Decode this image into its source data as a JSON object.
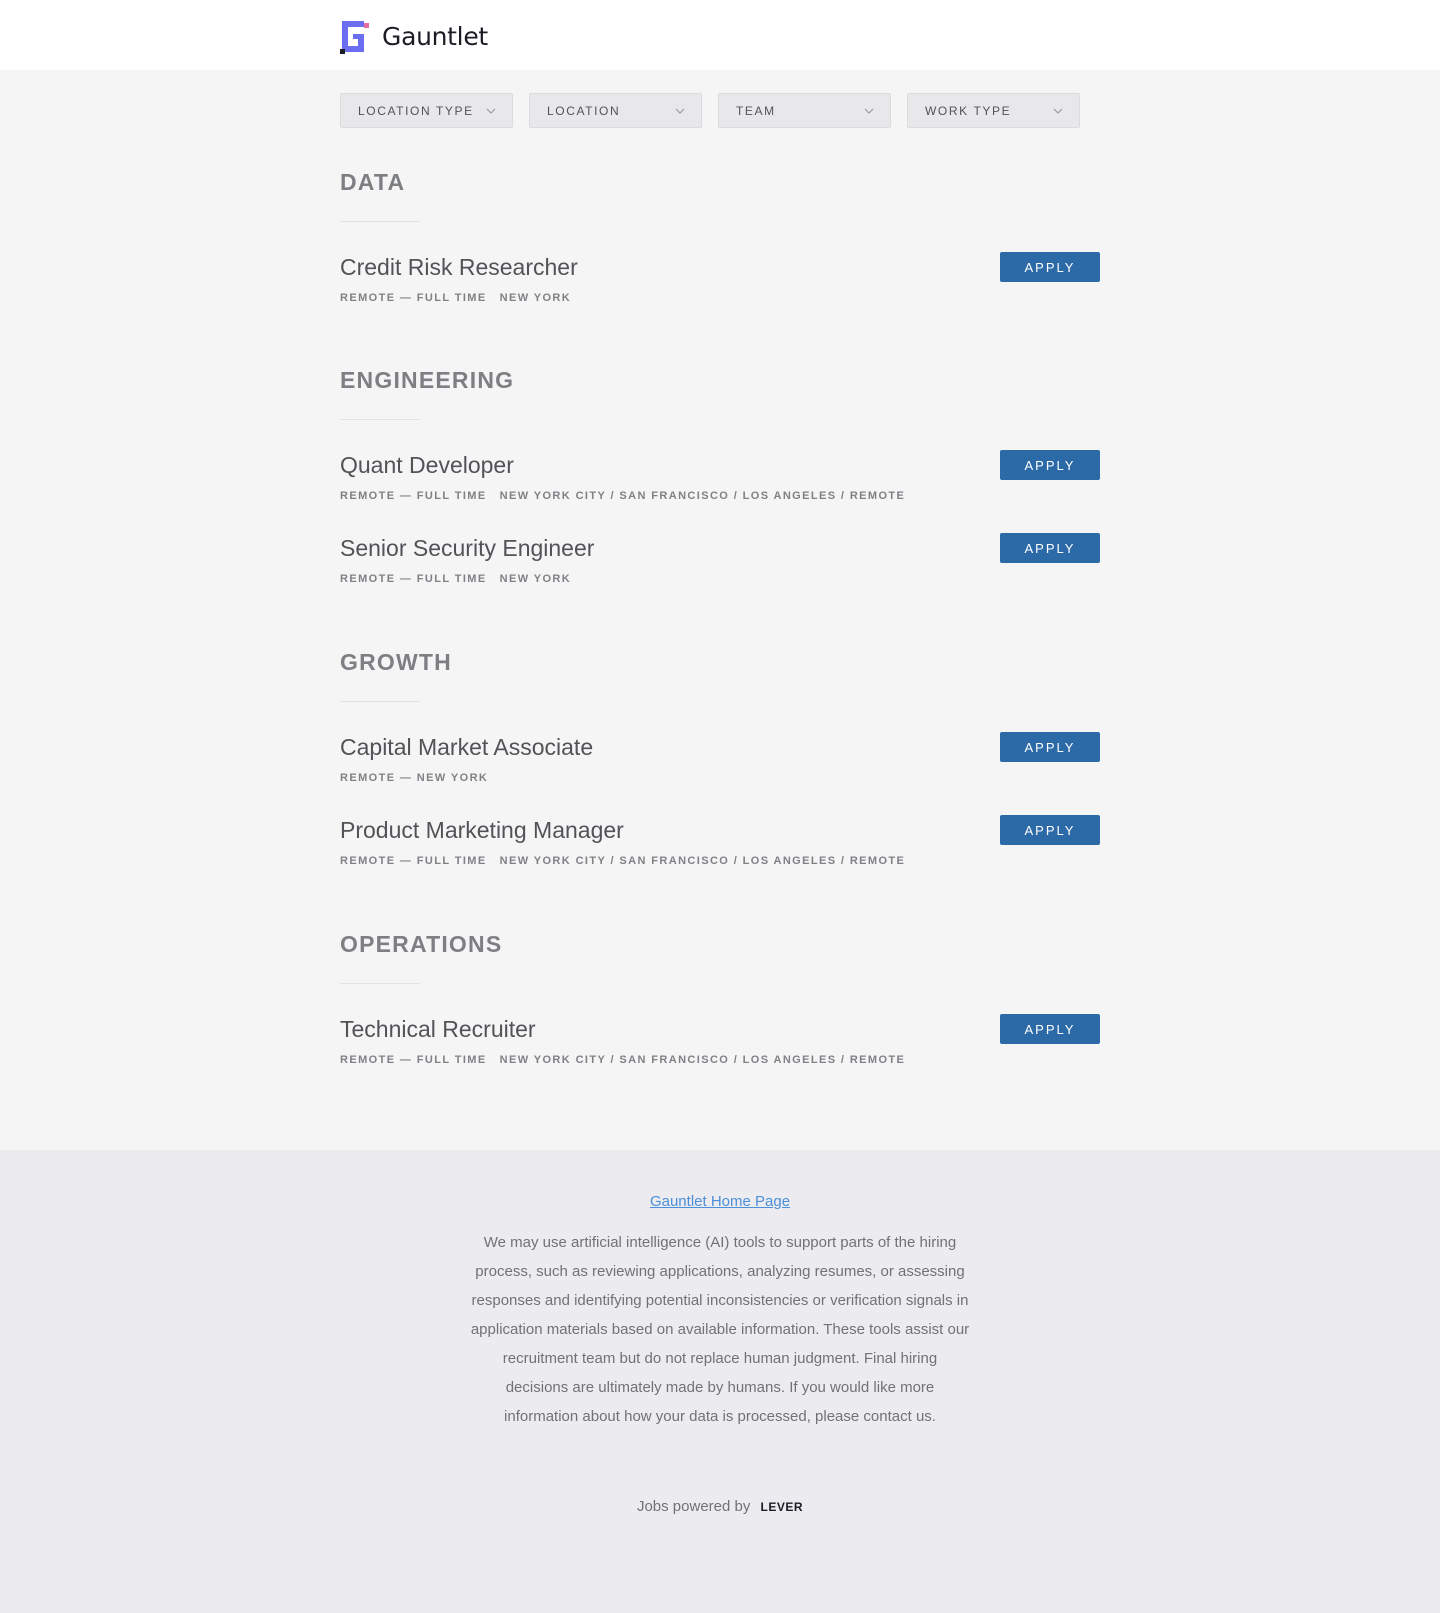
{
  "header": {
    "brand": "Gauntlet",
    "logo_icon": "gauntlet-logo-icon",
    "brand_colors": {
      "primary": "#6b6ef0",
      "accent": "#e96aa0",
      "dark": "#1c1c24"
    }
  },
  "filters": [
    {
      "label": "LOCATION TYPE"
    },
    {
      "label": "LOCATION"
    },
    {
      "label": "TEAM"
    },
    {
      "label": "WORK TYPE"
    }
  ],
  "groups": [
    {
      "title": "DATA",
      "postings": [
        {
          "title": "Credit Risk Researcher",
          "work_type": "REMOTE — FULL TIME",
          "location": "NEW YORK",
          "apply": "APPLY"
        }
      ]
    },
    {
      "title": "ENGINEERING",
      "postings": [
        {
          "title": "Quant Developer",
          "work_type": "REMOTE — FULL TIME",
          "location": "NEW YORK CITY / SAN FRANCISCO / LOS ANGELES / REMOTE",
          "apply": "APPLY"
        },
        {
          "title": "Senior Security Engineer",
          "work_type": "REMOTE — FULL TIME",
          "location": "NEW YORK",
          "apply": "APPLY"
        }
      ]
    },
    {
      "title": "GROWTH",
      "postings": [
        {
          "title": "Capital Market Associate",
          "work_type": "REMOTE — NEW YORK",
          "location": "",
          "apply": "APPLY"
        },
        {
          "title": "Product Marketing Manager",
          "work_type": "REMOTE — FULL TIME",
          "location": "NEW YORK CITY / SAN FRANCISCO / LOS ANGELES / REMOTE",
          "apply": "APPLY"
        }
      ]
    },
    {
      "title": "OPERATIONS",
      "postings": [
        {
          "title": "Technical Recruiter",
          "work_type": "REMOTE — FULL TIME",
          "location": "NEW YORK CITY / SAN FRANCISCO / LOS ANGELES / REMOTE",
          "apply": "APPLY"
        }
      ]
    }
  ],
  "footer": {
    "home_link": "Gauntlet Home Page",
    "ai_notice": "We may use artificial intelligence (AI) tools to support parts of the hiring process, such as reviewing applications, analyzing resumes, or assessing responses and identifying potential inconsistencies or verification signals in application materials based on available information. These tools assist our recruitment team but do not replace human judgment. Final hiring decisions are ultimately made by humans. If you would like more information about how your data is processed, please contact us.",
    "powered_by": "Jobs powered by",
    "lever": "LEVER"
  },
  "colors": {
    "apply_button": "#2b6aa6",
    "link": "#4d8fd8",
    "page_background": "#f5f5f6",
    "footer_background": "#ececf0"
  }
}
